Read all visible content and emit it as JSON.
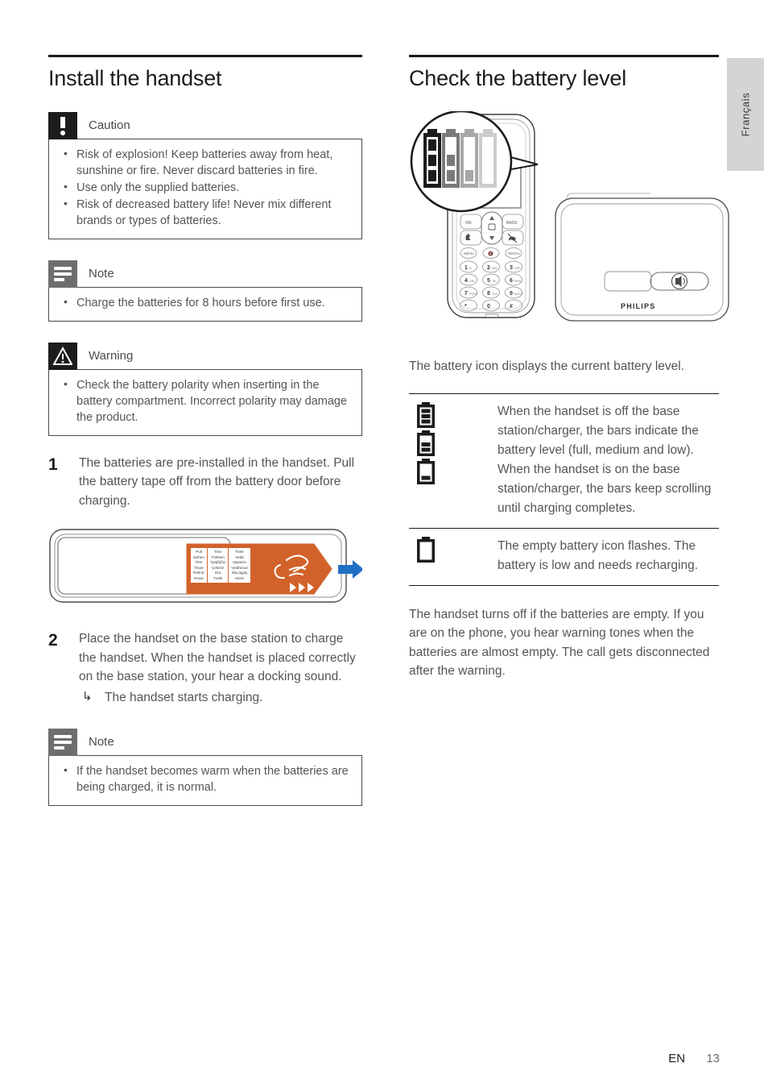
{
  "page": {
    "language_tab": "Français",
    "footer_language": "EN",
    "footer_page_number": "13"
  },
  "left_column": {
    "title": "Install the handset",
    "caution": {
      "label": "Caution",
      "icon": "exclamation-icon",
      "items": [
        "Risk of explosion! Keep batteries away from heat, sunshine or fire. Never discard batteries in fire.",
        "Use only the supplied batteries.",
        "Risk of decreased battery life! Never mix different brands or types of batteries."
      ]
    },
    "note_top": {
      "label": "Note",
      "icon": "note-lines-icon",
      "items": [
        "Charge the batteries for 8 hours before first use."
      ]
    },
    "warning": {
      "label": "Warning",
      "icon": "warning-triangle-icon",
      "items": [
        "Check the battery polarity when inserting in the battery compartment. Incorrect polarity may damage the product."
      ]
    },
    "step1": {
      "number": "1",
      "text": "The batteries are pre-installed in the handset. Pull the battery tape off from the battery door before charging."
    },
    "battery_door_illustration": {
      "tape_label_columns": [
        [
          "Pull",
          "Ziehen",
          "Tirer",
          "Tirare",
          "Retirar",
          "Puxar"
        ],
        [
          "Tirar",
          "Trekken",
          "Τραβήξτε",
          "Çekiniz",
          "Dra",
          "Trekk"
        ],
        [
          "Træk",
          "Vedä",
          "Удалить",
          "Vytáhnout",
          "Wyciągnij",
          "Húzni"
        ]
      ],
      "arrow_color": "#1f6fc4",
      "tape_color": "#d2622a"
    },
    "step2": {
      "number": "2",
      "text": "Place the handset on the base station to charge the handset. When the handset is placed correctly on the base station, your hear a docking sound.",
      "result_arrow": "↳",
      "result": "The handset starts charging."
    },
    "note_bottom": {
      "label": "Note",
      "icon": "note-lines-icon",
      "items": [
        "If the handset becomes warm when the batteries are being charged, it is normal."
      ]
    }
  },
  "right_column": {
    "title": "Check the battery level",
    "illustration": {
      "brand": "PHILIPS",
      "magnifier_battery_shades": [
        "#1c1c1c",
        "#7a7a7a",
        "#a8a8a8",
        "#cccccc"
      ],
      "keypad_keys": [
        [
          "OK",
          "",
          "BACK"
        ],
        [
          "1 ⊡",
          "2 ABC",
          "3 DEF"
        ],
        [
          "4 GHI",
          "5 JKL",
          "6 MNO"
        ],
        [
          "7 PQRS",
          "8 TUV",
          "9 WXYZ"
        ],
        [
          "* +",
          "0 ␣",
          "# ⇵"
        ]
      ],
      "soft_keys": [
        "MENU",
        "🔇",
        "REDIAL"
      ],
      "base_button": "speakerphone-icon"
    },
    "intro": "The battery icon displays the current battery level.",
    "table_rows": [
      {
        "icons": [
          "battery-full-icon",
          "battery-medium-icon",
          "battery-low-icon"
        ],
        "description": "When the handset is off the base station/charger, the bars indicate the battery level (full, medium and low).\nWhen the handset is on the base station/charger, the bars keep scrolling until charging completes."
      },
      {
        "icons": [
          "battery-empty-icon"
        ],
        "description": "The empty battery icon flashes. The battery is low and needs recharging."
      }
    ],
    "closing": "The handset turns off if the batteries are empty. If you are on the phone, you hear warning tones when the batteries are almost empty. The call gets disconnected after the warning."
  }
}
